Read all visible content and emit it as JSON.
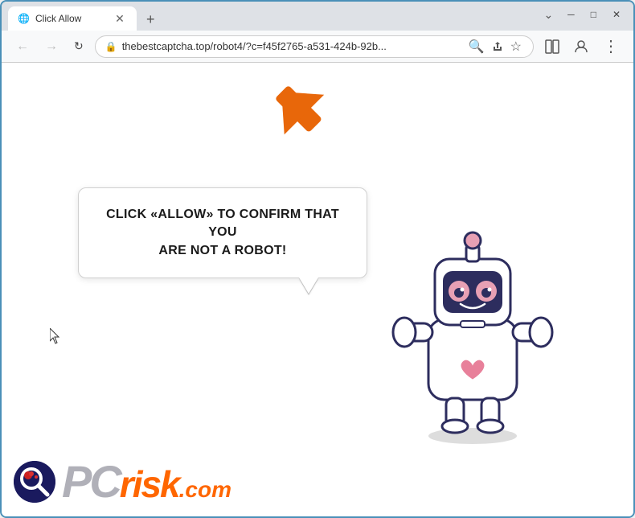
{
  "window": {
    "title": "Click Allow",
    "tab_label": "Click Allow",
    "new_tab_label": "+"
  },
  "window_controls": {
    "minimize": "─",
    "maximize": "□",
    "close": "✕"
  },
  "address_bar": {
    "url": "thebestcaptcha.top/robot4/?c=f45f2765-a531-424b-92b...",
    "back_label": "←",
    "forward_label": "→",
    "reload_label": "↻",
    "stop_label": "✕"
  },
  "toolbar": {
    "search_icon": "🔍",
    "share_icon": "⬆",
    "bookmark_icon": "☆",
    "split_icon": "▣",
    "profile_icon": "👤",
    "menu_icon": "⋮"
  },
  "page": {
    "bubble_text_line1": "CLICK «ALLOW» TO CONFIRM THAT YOU",
    "bubble_text_line2": "ARE NOT A ROBOT!"
  },
  "footer": {
    "logo_text_pc": "PC",
    "logo_text_risk": "risk",
    "logo_text_com": ".com"
  },
  "colors": {
    "arrow_orange": "#e8670a",
    "brand_orange": "#ff6600",
    "border_blue": "#4a90b8",
    "bubble_border": "#d0d0d0"
  }
}
